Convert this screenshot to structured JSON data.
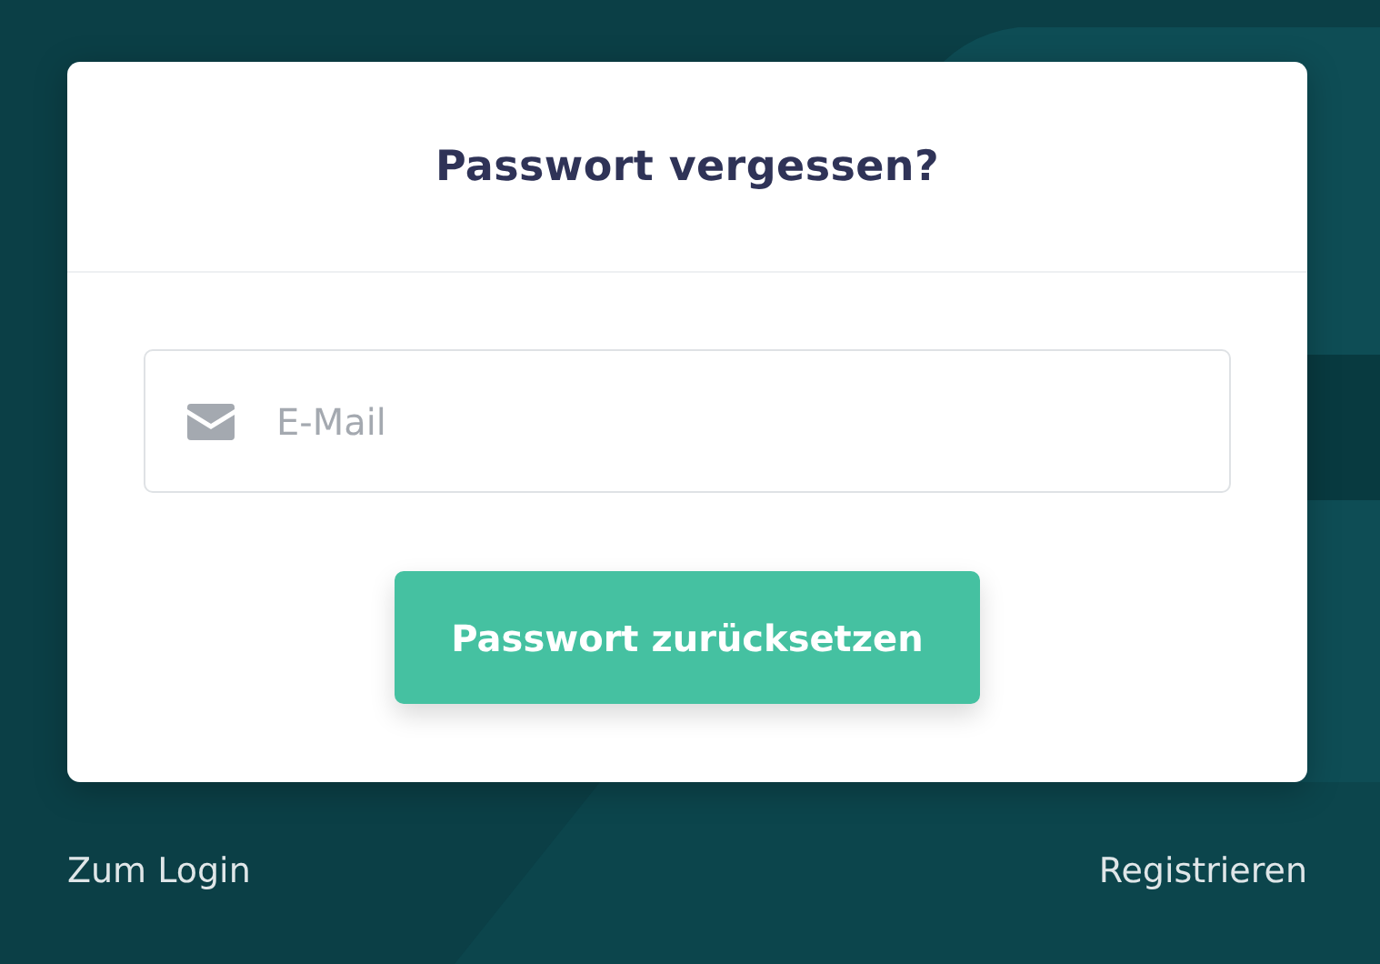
{
  "dialog": {
    "title": "Passwort vergessen?",
    "email_field": {
      "placeholder": "E-Mail"
    },
    "submit_button": "Passwort zurücksetzen"
  },
  "links": {
    "left": "Zum Login",
    "right": "Registrieren"
  }
}
